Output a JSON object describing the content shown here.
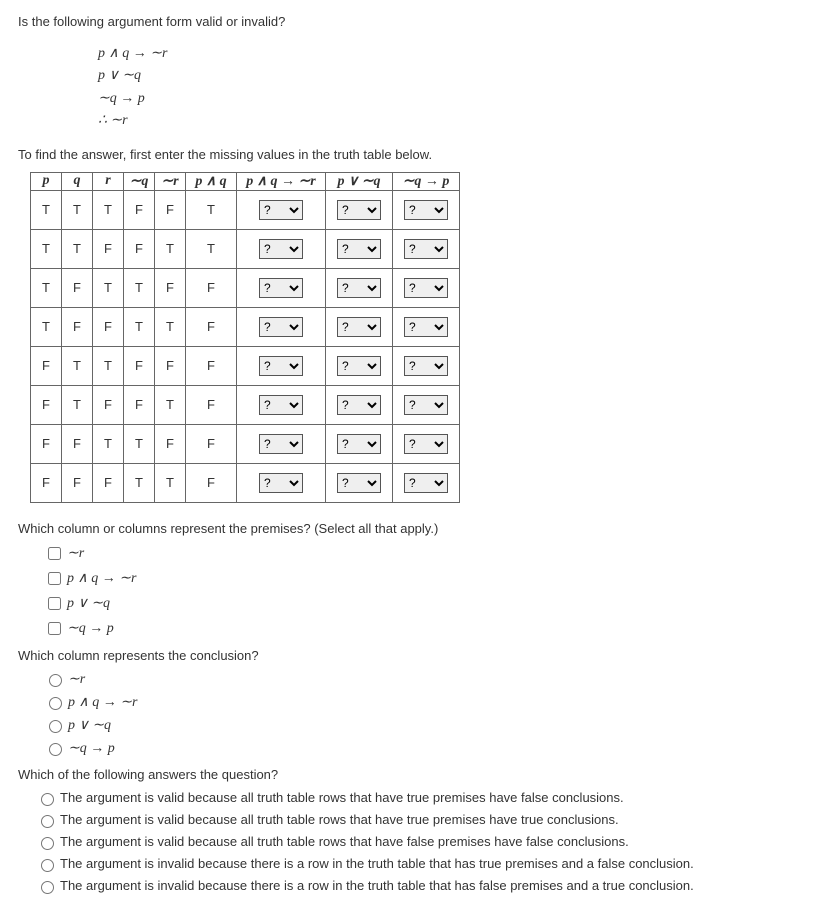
{
  "intro": "Is the following argument form valid or invalid?",
  "argument": {
    "l1": "p ∧ q → ∼r",
    "l2": "p ∨ ∼q",
    "l3": "∼q → p",
    "l4": "∴ ∼r"
  },
  "instruct": "To find the answer, first enter the missing values in the truth table below.",
  "headers": {
    "p": "p",
    "q": "q",
    "r": "r",
    "nq": "∼q",
    "nr": "∼r",
    "pandq": "p ∧ q",
    "impl": "p ∧ q → ∼r",
    "por": "p ∨ ∼q",
    "nqp": "∼q → p"
  },
  "rows": [
    {
      "p": "T",
      "q": "T",
      "r": "T",
      "nq": "F",
      "nr": "F",
      "pandq": "T"
    },
    {
      "p": "T",
      "q": "T",
      "r": "F",
      "nq": "F",
      "nr": "T",
      "pandq": "T"
    },
    {
      "p": "T",
      "q": "F",
      "r": "T",
      "nq": "T",
      "nr": "F",
      "pandq": "F"
    },
    {
      "p": "T",
      "q": "F",
      "r": "F",
      "nq": "T",
      "nr": "T",
      "pandq": "F"
    },
    {
      "p": "F",
      "q": "T",
      "r": "T",
      "nq": "F",
      "nr": "F",
      "pandq": "F"
    },
    {
      "p": "F",
      "q": "T",
      "r": "F",
      "nq": "F",
      "nr": "T",
      "pandq": "F"
    },
    {
      "p": "F",
      "q": "F",
      "r": "T",
      "nq": "T",
      "nr": "F",
      "pandq": "F"
    },
    {
      "p": "F",
      "q": "F",
      "r": "F",
      "nq": "T",
      "nr": "T",
      "pandq": "F"
    }
  ],
  "dropdown_placeholder": "?",
  "q_premises": "Which column or columns represent the premises? (Select all that apply.)",
  "q_conclusion": "Which column represents the conclusion?",
  "choices": {
    "a": "∼r",
    "b": "p ∧ q → ∼r",
    "c": "p ∨ ∼q",
    "d": "∼q → p"
  },
  "q_final": "Which of the following answers the question?",
  "final_choices": {
    "a": "The argument is valid because all truth table rows that have true premises have false conclusions.",
    "b": "The argument is valid because all truth table rows that have true premises have true conclusions.",
    "c": "The argument is valid because all truth table rows that have false premises have false conclusions.",
    "d": "The argument is invalid because there is a row in the truth table that has true premises and a false conclusion.",
    "e": "The argument is invalid because there is a row in the truth table that has false premises and a true conclusion."
  }
}
